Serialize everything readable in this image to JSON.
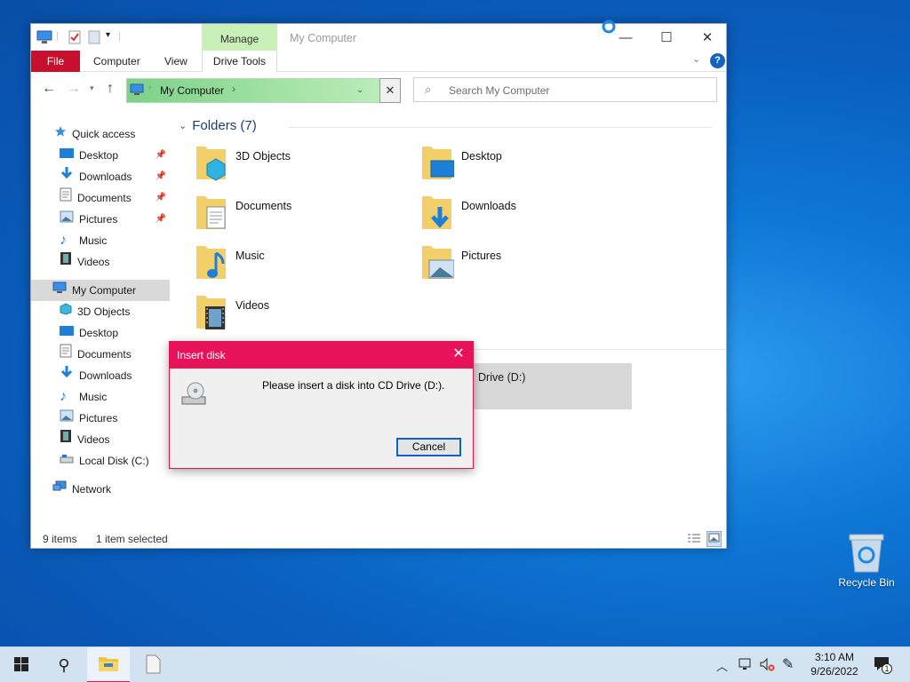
{
  "window": {
    "title": "My Computer",
    "contextual_tab": "Manage",
    "tabs": {
      "file": "File",
      "computer": "Computer",
      "view": "View",
      "drive_tools": "Drive Tools"
    },
    "address": {
      "location": "My Computer"
    },
    "search": {
      "placeholder": "Search My Computer"
    }
  },
  "nav": {
    "quick_access": "Quick access",
    "quick_items": [
      "Desktop",
      "Downloads",
      "Documents",
      "Pictures",
      "Music",
      "Videos"
    ],
    "computer": "My Computer",
    "computer_items": [
      "3D Objects",
      "Desktop",
      "Documents",
      "Downloads",
      "Music",
      "Pictures",
      "Videos",
      "Local Disk (C:)"
    ],
    "network": "Network"
  },
  "content": {
    "section": "Folders (7)",
    "folders": [
      "3D Objects",
      "Desktop",
      "Documents",
      "Downloads",
      "Music",
      "Pictures",
      "Videos"
    ],
    "drive_label": "Drive (D:)"
  },
  "status": {
    "items": "9 items",
    "selected": "1 item selected"
  },
  "dialog": {
    "title": "Insert disk",
    "message": "Please insert a disk into CD Drive (D:).",
    "cancel": "Cancel"
  },
  "desktop": {
    "recycle_bin": "Recycle Bin"
  },
  "taskbar": {
    "time": "3:10 AM",
    "date": "9/26/2022",
    "notification_count": "1"
  },
  "colors": {
    "accent_red": "#c8102e",
    "dialog_title": "#e8125a",
    "manage_green": "#c9f0b8",
    "address_green": "#7ed18a",
    "button_focus": "#0b63c9"
  }
}
